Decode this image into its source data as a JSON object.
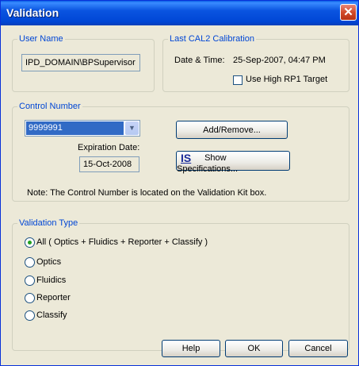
{
  "window": {
    "title": "Validation",
    "close_label": "✕"
  },
  "user_name": {
    "legend": "User Name",
    "value": "IPD_DOMAIN\\BPSupervisor"
  },
  "calibration": {
    "legend": "Last CAL2 Calibration",
    "datetime_label": "Date & Time:",
    "datetime_value": "25-Sep-2007, 04:47 PM",
    "high_rp1_label": "Use High RP1 Target",
    "high_rp1_checked": false
  },
  "control_number": {
    "legend": "Control Number",
    "selected": "9999991",
    "expiration_label": "Expiration Date:",
    "expiration_value": "15-Oct-2008",
    "add_remove_label": "Add/Remove...",
    "show_specs_label": "Show Specifications...",
    "show_specs_icon_text": "IS",
    "note": "Note: The Control Number is located on the Validation Kit box."
  },
  "validation_type": {
    "legend": "Validation Type",
    "options": [
      {
        "label": "All  ( Optics + Fluidics + Reporter + Classify )",
        "selected": true
      },
      {
        "label": "Optics",
        "selected": false
      },
      {
        "label": "Fluidics",
        "selected": false
      },
      {
        "label": "Reporter",
        "selected": false
      },
      {
        "label": "Classify",
        "selected": false
      }
    ]
  },
  "buttons": {
    "help": "Help",
    "ok": "OK",
    "cancel": "Cancel"
  }
}
